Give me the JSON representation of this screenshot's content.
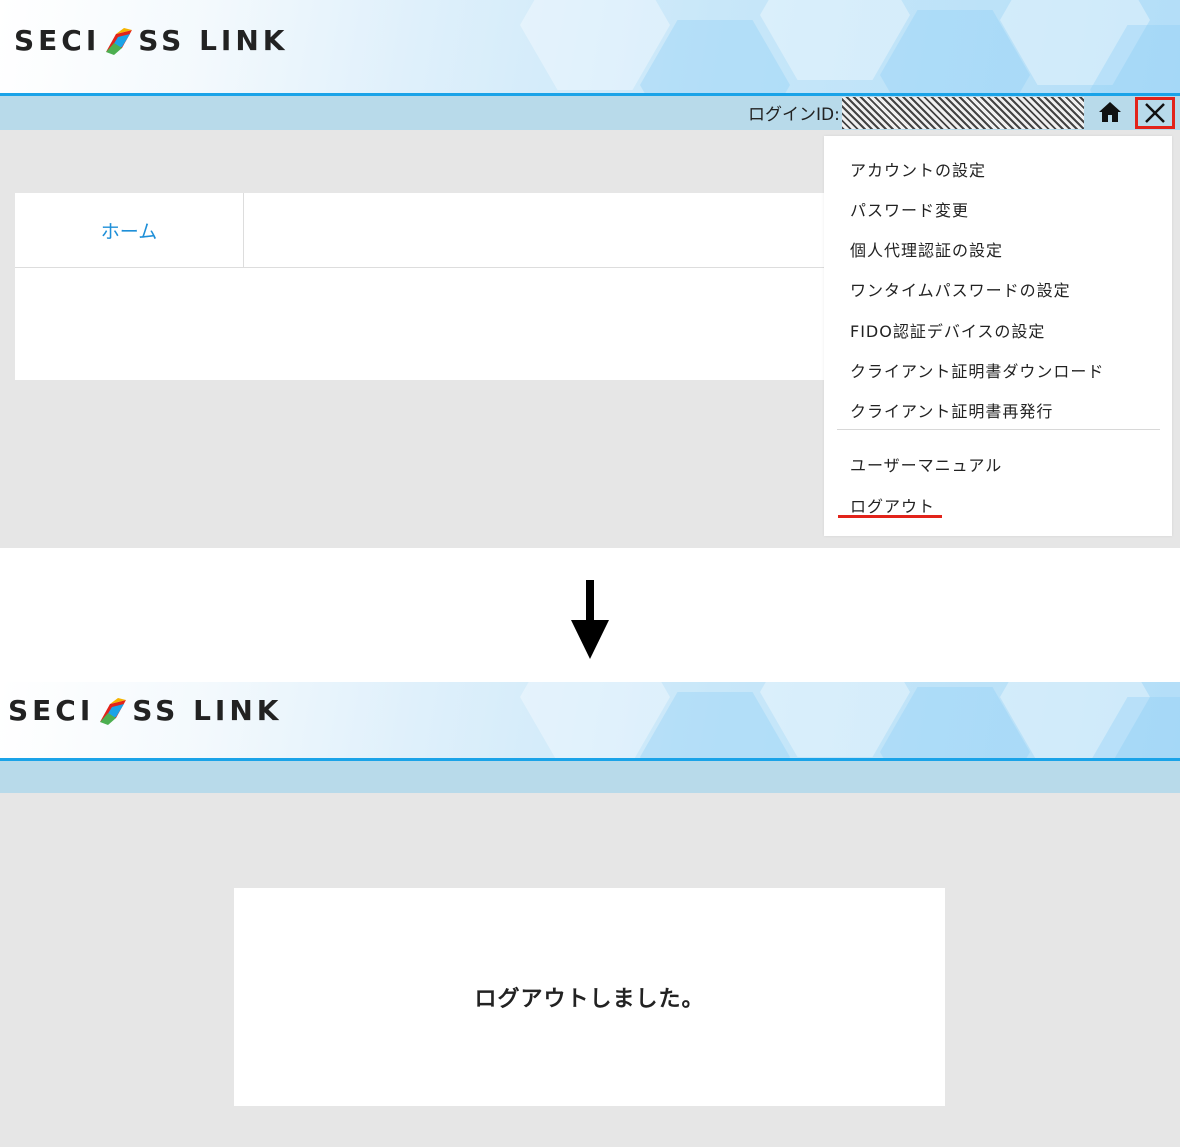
{
  "brand": {
    "logo_text_left": "SECI",
    "logo_text_right": "SS LINK"
  },
  "before": {
    "userbar": {
      "login_label": "ログインID:"
    },
    "home_tab": {
      "label": "ホーム"
    },
    "menu": {
      "items": [
        "アカウントの設定",
        "パスワード変更",
        "個人代理認証の設定",
        "ワンタイムパスワードの設定",
        "FIDO認証デバイスの設定",
        "クライアント証明書ダウンロード",
        "クライアント証明書再発行"
      ],
      "secondary_items": [
        "ユーザーマニュアル",
        "ログアウト"
      ]
    }
  },
  "after": {
    "message": "ログアウトしました。"
  },
  "colors": {
    "accent_blue": "#1aa3e8",
    "highlight_red": "#e2231a",
    "link_blue": "#1e8fd8"
  },
  "icons": {
    "home": "home-icon",
    "close": "close-icon",
    "flow": "arrow-down-icon"
  }
}
